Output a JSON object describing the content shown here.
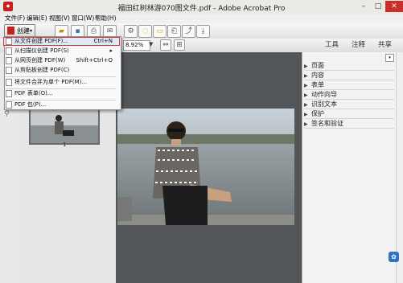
{
  "window": {
    "title": "福田红树林游070图文件.pdf - Adobe Acrobat Pro",
    "minimize": "–",
    "maximize": "□",
    "close": "✕"
  },
  "menubar": [
    "文件(F)",
    "编辑(E)",
    "视图(V)",
    "窗口(W)",
    "帮助(H)"
  ],
  "toolbar": {
    "create_label": "创建",
    "zoom_value": "8.92%"
  },
  "right_tabs": [
    "工具",
    "注释",
    "共享"
  ],
  "right_panel": {
    "sections": [
      "页面",
      "内容",
      "表单",
      "动作向导",
      "识别文本",
      "保护",
      "签名和验证"
    ]
  },
  "create_menu": [
    {
      "label": "从文件创建 PDF(F)...",
      "shortcut": "Ctrl+N"
    },
    {
      "label": "从扫描仪创建 PDF(S)",
      "shortcut": "▸"
    },
    {
      "label": "从网页创建 PDF(W)",
      "shortcut": "Shift+Ctrl+O"
    },
    {
      "label": "从剪贴板创建 PDF(C)",
      "shortcut": ""
    },
    {
      "label": "将文件合并为单个 PDF(M)...",
      "shortcut": ""
    },
    {
      "label": "PDF 表单(O)...",
      "shortcut": ""
    },
    {
      "label": "PDF 包(P)...",
      "shortcut": ""
    }
  ],
  "thumbnail": {
    "page_number": "1"
  },
  "watermark_icon": "paw-icon"
}
